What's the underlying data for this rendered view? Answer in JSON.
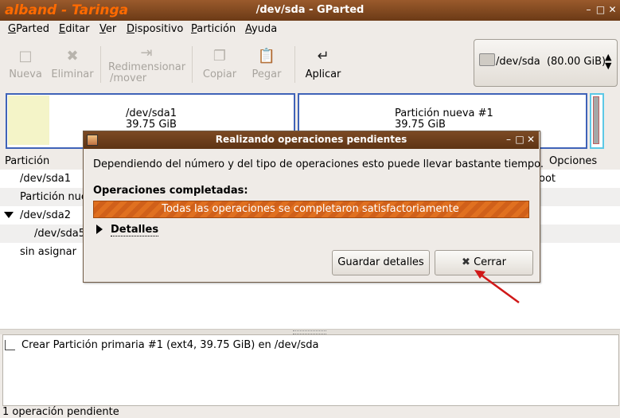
{
  "window": {
    "wm_label": "alband - Taringa",
    "title": "/dev/sda - GParted"
  },
  "menu": [
    {
      "label": "GParted",
      "u": "G",
      "rest": "Parted"
    },
    {
      "label": "Editar",
      "u": "E",
      "rest": "ditar"
    },
    {
      "label": "Ver",
      "u": "V",
      "rest": "er"
    },
    {
      "label": "Dispositivo",
      "u": "D",
      "rest": "ispositivo"
    },
    {
      "label": "Partición",
      "u": "P",
      "rest": "artición"
    },
    {
      "label": "Ayuda",
      "u": "A",
      "rest": "yuda"
    }
  ],
  "toolbar": {
    "new": "Nueva",
    "delete": "Eliminar",
    "resize1": "Redimensionar",
    "resize2": "/mover",
    "copy": "Copiar",
    "paste": "Pegar",
    "apply": "Aplicar"
  },
  "device": {
    "name": "/dev/sda",
    "size": "(80.00 GiB)"
  },
  "graph": {
    "p1_name": "/dev/sda1",
    "p1_size": "39.75 GiB",
    "p2_name": "Partición nueva #1",
    "p2_size": "39.75 GiB"
  },
  "list": {
    "col_partition": "Partición",
    "col_flags": "Opciones",
    "rows": [
      "/dev/sda1",
      "Partición nue",
      "/dev/sda2",
      "/dev/sda5",
      "sin asignar"
    ],
    "flag_fragment": "oot"
  },
  "operations": {
    "item": "Crear Partición primaria #1 (ext4, 39.75 GiB) en /dev/sda",
    "status": "1 operación pendiente"
  },
  "dialog": {
    "title": "Realizando operaciones pendientes",
    "message": "Dependiendo del número y del tipo de operaciones esto puede llevar bastante tiempo.",
    "completed_label": "Operaciones completadas:",
    "progress_text": "Todas las operaciones se completaron satisfactoriamente",
    "progress_value": 1.0,
    "details_label": "Detalles",
    "save_details": "Guardar detalles",
    "close": "Cerrar"
  },
  "colors": {
    "accent": "#e07020",
    "partition_border": "#3f63b8",
    "arrow": "#d01818"
  }
}
